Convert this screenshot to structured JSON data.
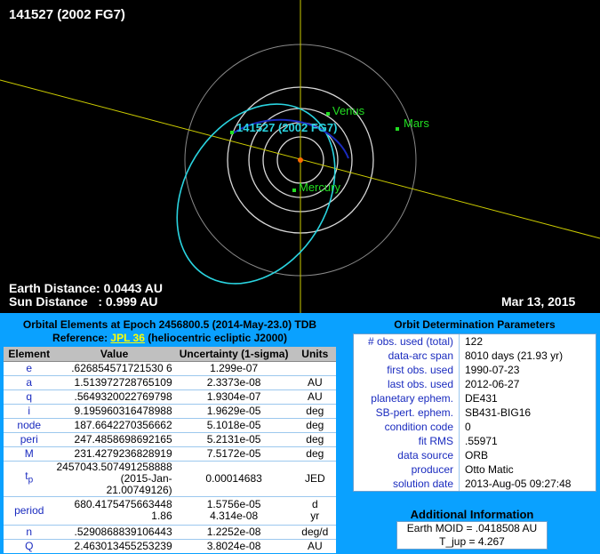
{
  "viewer": {
    "title": "141527 (2002 FG7)",
    "orbit_label": "141527 (2002 FG7)",
    "planets": [
      "Venus",
      "Mars",
      "Mercury"
    ],
    "earth_distance": "Earth Distance: 0.0443 AU",
    "sun_distance": "Sun Distance   : 0.999 AU",
    "date": "Mar 13, 2015"
  },
  "orbital_elements": {
    "heading": "Orbital Elements at Epoch 2456800.5 (2014-May-23.0) TDB",
    "reference_prefix": "Reference: ",
    "reference_link": "JPL 36",
    "reference_suffix": " (heliocentric ecliptic J2000)",
    "columns": [
      "Element",
      "Value",
      "Uncertainty (1-sigma)",
      "Units"
    ],
    "rows": [
      {
        "name": "e",
        "value": ".626854571721530 6",
        "unc": "1.299e-07",
        "unit": ""
      },
      {
        "name": "a",
        "value": "1.513972728765109",
        "unc": "2.3373e-08",
        "unit": "AU"
      },
      {
        "name": "q",
        "value": ".5649320022769798",
        "unc": "1.9304e-07",
        "unit": "AU"
      },
      {
        "name": "i",
        "value": "9.195960316478988",
        "unc": "1.9629e-05",
        "unit": "deg"
      },
      {
        "name": "node",
        "value": "187.6642270356662",
        "unc": "5.1018e-05",
        "unit": "deg"
      },
      {
        "name": "peri",
        "value": "247.4858698692165",
        "unc": "5.2131e-05",
        "unit": "deg"
      },
      {
        "name": "M",
        "value": "231.4279236828919",
        "unc": "7.5172e-05",
        "unit": "deg"
      }
    ],
    "tp": {
      "name": "t",
      "sub": "p",
      "value1": "2457043.507491258888",
      "value2": "(2015-Jan-21.00749126)",
      "unc": "0.00014683",
      "unit": "JED"
    },
    "period": {
      "name": "period",
      "value1": "680.4175475663448",
      "unc1": "1.5756e-05",
      "unit1": "d",
      "value2": "1.86",
      "unc2": "4.314e-08",
      "unit2": "yr"
    },
    "rows2": [
      {
        "name": "n",
        "value": ".5290868839106443",
        "unc": "1.2252e-08",
        "unit": "deg/d"
      },
      {
        "name": "Q",
        "value": "2.463013455253239",
        "unc": "3.8024e-08",
        "unit": "AU"
      }
    ]
  },
  "orbit_determination": {
    "heading": "Orbit Determination Parameters",
    "rows": [
      {
        "label": "# obs. used (total)",
        "value": "122"
      },
      {
        "label": "data-arc span",
        "value": "8010 days (21.93 yr)"
      },
      {
        "label": "first obs. used",
        "value": "1990-07-23"
      },
      {
        "label": "last obs. used",
        "value": "2012-06-27"
      },
      {
        "label": "planetary ephem.",
        "value": "DE431"
      },
      {
        "label": "SB-pert. ephem.",
        "value": "SB431-BIG16"
      },
      {
        "label": "condition code",
        "value": "0"
      },
      {
        "label": "fit RMS",
        "value": ".55971"
      },
      {
        "label": "data source",
        "value": "ORB"
      },
      {
        "label": "producer",
        "value": "Otto Matic"
      },
      {
        "label": "solution date",
        "value": "2013-Aug-05 09:27:48"
      }
    ]
  },
  "additional_info": {
    "heading": "Additional Information",
    "moid": "Earth MOID = .0418508 AU",
    "tjup": "T_jup = 4.267"
  },
  "colors": {
    "background": "#0aa1ff",
    "viewer_bg": "#000000",
    "label_blue": "#1a2bbf",
    "orbit_cyan": "#2ad4e0",
    "planet_green": "#22dd22",
    "ecliptic_yellow": "#cccc00"
  }
}
